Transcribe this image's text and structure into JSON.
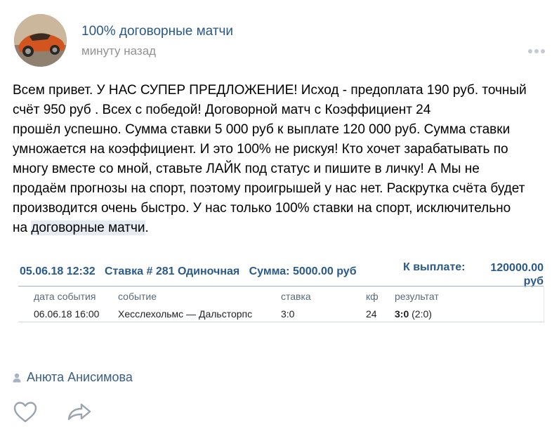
{
  "post": {
    "group_name": "100% договорные матчи",
    "time": "минуту назад",
    "text_lines": [
      "Всем привет. У НАС СУПЕР ПРЕДЛОЖЕНИЕ! Исход - предоплата 190 руб. точный",
      "счёт 950 руб . Всех с победой! Договорной матч с Коэффициент 24",
      "прошёл успешно. Сумма ставки 5 000 руб к выплате 120 000 руб. Сумма ставки",
      "умножается на коэффициент. И это 100% не рискуя! Кто хочет зарабатывать по",
      "многу вместе со мной, ставьте ЛАЙК под статус и пишите в личку! А Мы не",
      "продаём прогнозы на спорт, поэтому проигрышей у нас нет. Раскрутка счёта будет",
      "производится очень быстро. У нас только 100% ставки на спорт, исключительно"
    ],
    "last_line_prefix": "на ",
    "last_line_highlight": "договорные матчи",
    "last_line_suffix": ".",
    "author": "Анюта Анисимова"
  },
  "bet": {
    "date": "05.06.18 12:32",
    "bet_label": "Ставка # 281 Одиночная",
    "sum_label": "Сумма: 5000.00 руб",
    "payout_label": "К выплате:",
    "payout_amount": "120000.00",
    "payout_currency": "руб",
    "headers": {
      "date": "дата события",
      "event": "событие",
      "stake": "ставка",
      "coef": "кф",
      "result": "результат"
    },
    "row": {
      "date": "06.06.18 16:00",
      "event": "Хесслехольмс — Дальсторпс",
      "stake": "3:0",
      "coef": "24",
      "result_main": "3:0",
      "result_detail": " (2:0)"
    }
  },
  "icons": {
    "more": "more-dots-icon",
    "like": "heart-icon",
    "share": "share-arrow-icon",
    "author": "user-icon"
  },
  "colors": {
    "link": "#2a5885",
    "muted": "#939393",
    "bet_blue": "#2a5a8a",
    "highlight": "#e7ecf2"
  }
}
